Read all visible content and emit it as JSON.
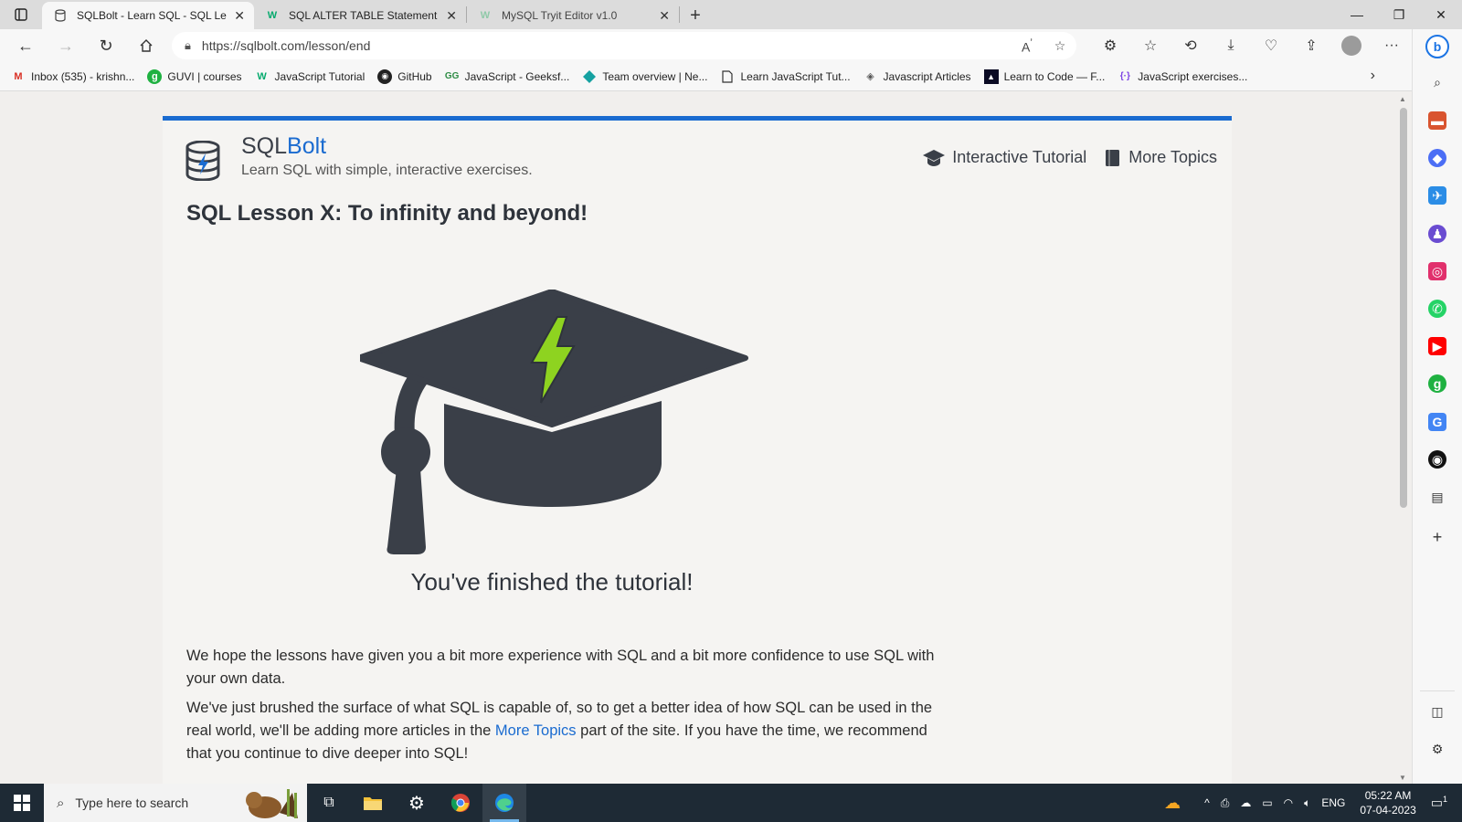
{
  "browser": {
    "tabs": [
      {
        "title": "SQLBolt - Learn SQL - SQL Lesso",
        "active": true
      },
      {
        "title": "SQL ALTER TABLE Statement",
        "active": false
      },
      {
        "title": "MySQL Tryit Editor v1.0",
        "active": false
      }
    ],
    "url": "https://sqlbolt.com/lesson/end",
    "favorites": [
      {
        "label": "Inbox (535) - krishn...",
        "icon": "gmail-icon"
      },
      {
        "label": "GUVI | courses",
        "icon": "guvi-icon"
      },
      {
        "label": "JavaScript Tutorial",
        "icon": "w3schools-icon"
      },
      {
        "label": "GitHub",
        "icon": "github-icon"
      },
      {
        "label": "JavaScript - Geeksf...",
        "icon": "geeksforgeeks-icon"
      },
      {
        "label": "Team overview | Ne...",
        "icon": "netlify-icon"
      },
      {
        "label": "Learn JavaScript Tut...",
        "icon": "page-icon"
      },
      {
        "label": "Javascript Articles",
        "icon": "articles-icon"
      },
      {
        "label": "Learn to Code — F...",
        "icon": "freecodecamp-icon"
      },
      {
        "label": "JavaScript exercises...",
        "icon": "exercises-icon"
      }
    ]
  },
  "site": {
    "brand_sql": "SQL",
    "brand_bolt": "Bolt",
    "tagline": "Learn SQL with simple, interactive exercises.",
    "nav_tutorial": "Interactive Tutorial",
    "nav_topics": "More Topics",
    "accent": "#1a6bd0"
  },
  "lesson": {
    "title": "SQL Lesson X: To infinity and beyond!",
    "finished": "You've finished the tutorial!",
    "para1": "We hope the lessons have given you a bit more experience with SQL and a bit more confidence to use SQL with your own data.",
    "para2_before": "We've just brushed the surface of what SQL is capable of, so to get a better idea of how SQL can be used in the real world, we'll be adding more articles in the ",
    "para2_link": "More Topics",
    "para2_after": " part of the site. If you have the time, we recommend that you continue to dive deeper into SQL!"
  },
  "taskbar": {
    "search_placeholder": "Type here to search",
    "language": "ENG",
    "time": "05:22 AM",
    "date": "07-04-2023",
    "notifications": "1"
  }
}
